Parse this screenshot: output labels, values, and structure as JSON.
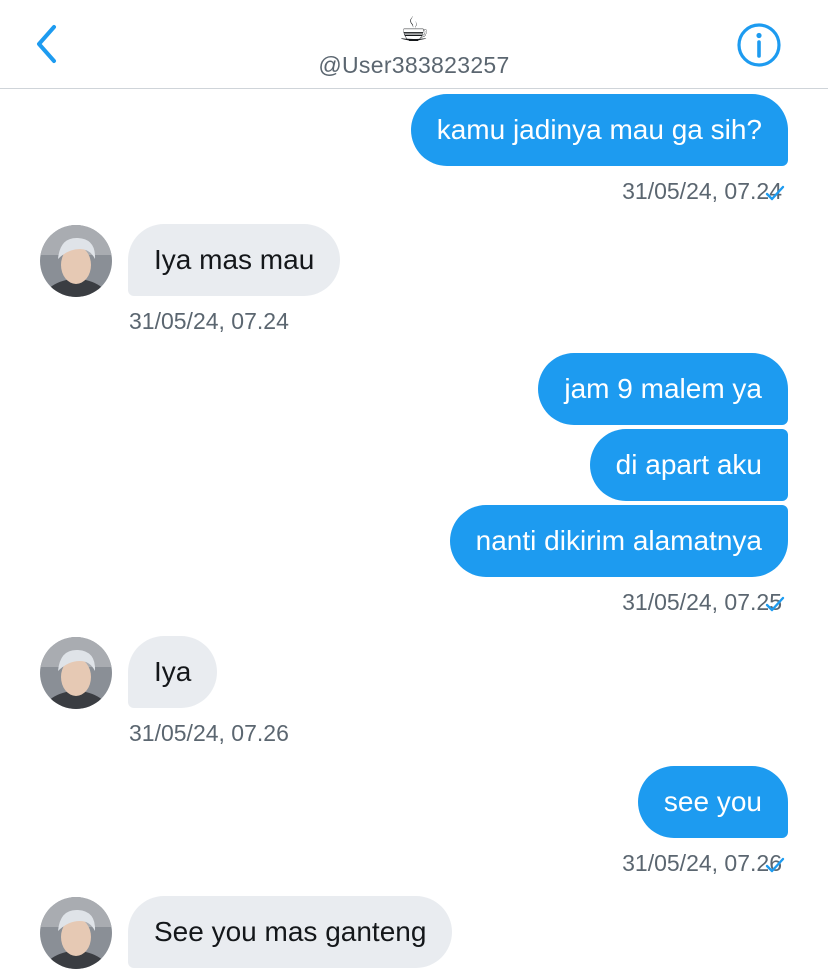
{
  "header": {
    "emoji": "☕",
    "handle": "@User383823257"
  },
  "messages": [
    {
      "text": "kamu jadinya mau ga sih?",
      "from": "me"
    },
    {
      "time": "31/05/24, 07.24"
    },
    {
      "text": "Iya mas mau",
      "from": "them"
    },
    {
      "time": "31/05/24, 07.24"
    },
    {
      "text": "jam 9 malem ya",
      "from": "me"
    },
    {
      "text": "di apart aku",
      "from": "me"
    },
    {
      "text": "nanti dikirim alamatnya",
      "from": "me"
    },
    {
      "time": "31/05/24, 07.25"
    },
    {
      "text": "Iya",
      "from": "them"
    },
    {
      "time": "31/05/24, 07.26"
    },
    {
      "text": "see you",
      "from": "me"
    },
    {
      "time": "31/05/24, 07.26"
    },
    {
      "text": "See you mas ganteng",
      "from": "them"
    }
  ],
  "colors": {
    "accent": "#1d9bf0",
    "incoming_bubble": "#e9ecf0",
    "muted_text": "#5b6670"
  },
  "icons": {
    "back": "chevron-left-icon",
    "info": "info-circle-icon",
    "read": "checkmark-icon"
  }
}
